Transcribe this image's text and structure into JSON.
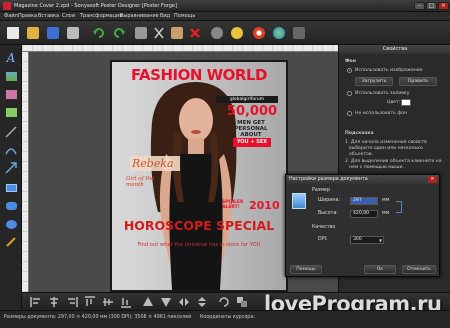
{
  "window": {
    "title": "Magazine Cover 2.zpd - Sonyasoft Poster Designer [Poster Forge]",
    "min": "–",
    "max": "□",
    "close": "×"
  },
  "menu": [
    "Файл",
    "Правка",
    "Вставка",
    "Слои",
    "Трансформация",
    "Выравнивание",
    "Вид",
    "Помощь"
  ],
  "toolbar_icons": [
    "new-icon",
    "open-icon",
    "save-icon",
    "print-icon",
    "undo-icon",
    "redo-icon",
    "copy-icon",
    "cut-icon",
    "paste-icon",
    "delete-icon",
    "settings-icon",
    "wizard-icon",
    "help-icon",
    "web-icon",
    "exit-icon"
  ],
  "cover": {
    "title": "FASHION WORLD",
    "site": "globalgirlforum",
    "big_number": "50,000",
    "men_line1": "MEN GET",
    "men_line2": "PERSONAL",
    "men_line3": "ABOUT",
    "you_sex": "YOU + SEX",
    "name": "Rebeka",
    "girl_line": "Girl of the month",
    "spoiler": "SPOILER ALERT!",
    "year": "2010",
    "horoscope": "HOROSCOPE SPECIAL",
    "find": "Find out what the Universe has in store for YOU"
  },
  "properties": {
    "header": "Свойства",
    "section_bg": "Фон",
    "use_image": "Использовать изображение",
    "load_btn": "Загрузить",
    "apply_btn": "Править",
    "use_fill": "Использовать заливку",
    "color_label": "Цвет:",
    "no_bg": "Не использовать фон",
    "hint_header": "Подсказка",
    "hint1": "1. Для начала изменения свойств",
    "hint1b": "выберите один или несколько",
    "hint1c": "объектов.",
    "hint2": "2. Для выделения объекта кликните на",
    "hint2b": "нем с помощью мыши."
  },
  "dialog": {
    "title": "Настройки размера документа",
    "size_label": "Размер",
    "width_label": "Ширина:",
    "width_value": "297",
    "height_label": "Высота:",
    "height_value": "420,00",
    "unit": "мм",
    "quality_label": "Качество",
    "dpi_label": "DPI:",
    "dpi_value": "300",
    "help_btn": "Помощь",
    "ok_btn": "Ок",
    "cancel_btn": "Отменить"
  },
  "status": {
    "size": "Размеры документа: 297,00 × 420,00 мм (300 DPI); 3508 × 4961 пикселей",
    "coords": "Координаты курсора:"
  },
  "watermark": "loveProgram.ru",
  "colors": {
    "accent_red": "#e8112d",
    "panel_bg": "#2a2a2a"
  }
}
